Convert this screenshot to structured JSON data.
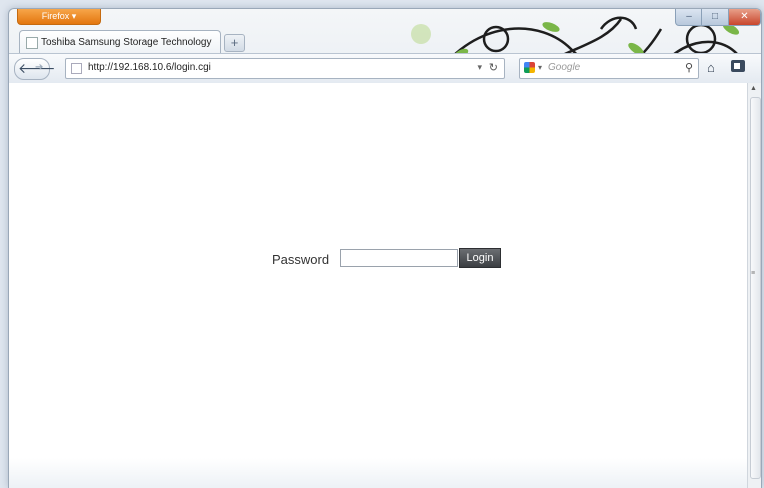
{
  "window": {
    "app_button_label": "Firefox ▾",
    "controls": {
      "minimize": "–",
      "maximize": "□",
      "close": "✕"
    }
  },
  "tab": {
    "title": "Toshiba Samsung Storage Technology",
    "new_tab_label": "+"
  },
  "navbar": {
    "url": "http://192.168.10.6/login.cgi",
    "search_placeholder": "Google",
    "back_glyph": "🡐",
    "forward_glyph": "➔"
  },
  "page": {
    "password_label": "Password",
    "password_value": "",
    "login_button_label": "Login"
  },
  "colors": {
    "firefox_orange": "#e3760f",
    "login_button": "#4a4d51"
  }
}
